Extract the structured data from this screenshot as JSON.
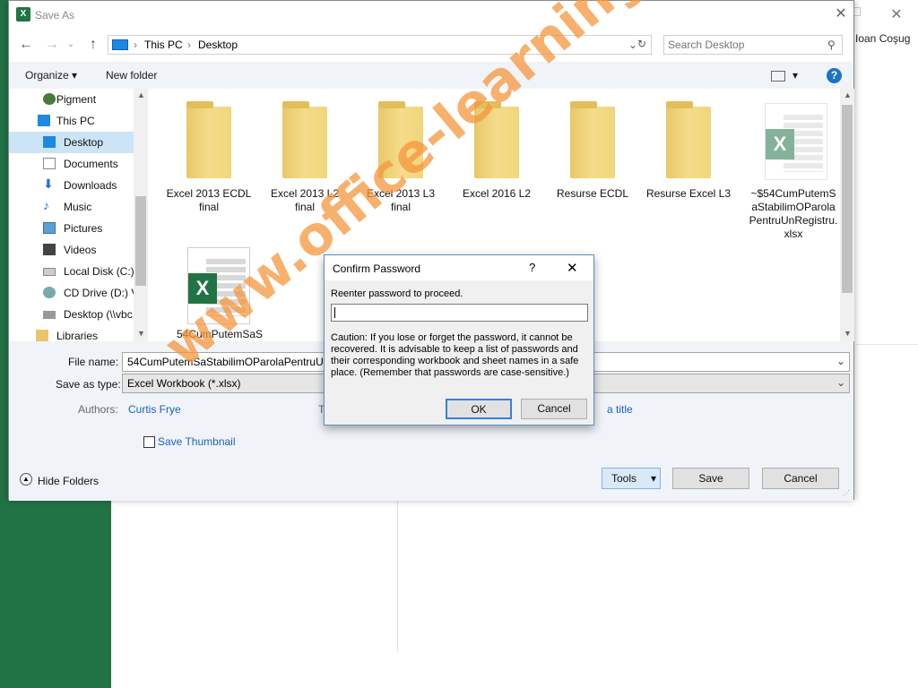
{
  "colors": {
    "excel_green": "#217346",
    "accent_blue": "#1a73c9",
    "selected": "#cce4f7",
    "watermark": "#f5963c"
  },
  "excel": {
    "user_name": "Ioan Coşug"
  },
  "save_as": {
    "title": "Save As",
    "breadcrumb": [
      "This PC",
      "Desktop"
    ],
    "search_placeholder": "Search Desktop",
    "toolbar": {
      "organize": "Organize",
      "new_folder": "New folder"
    },
    "nav": [
      {
        "label": "Pigment",
        "icon": "user-icon"
      },
      {
        "label": "This PC",
        "icon": "computer-icon"
      },
      {
        "label": "Desktop",
        "icon": "desktop-icon"
      },
      {
        "label": "Documents",
        "icon": "document-icon"
      },
      {
        "label": "Downloads",
        "icon": "download-icon"
      },
      {
        "label": "Music",
        "icon": "music-icon"
      },
      {
        "label": "Pictures",
        "icon": "picture-icon"
      },
      {
        "label": "Videos",
        "icon": "video-icon"
      },
      {
        "label": "Local Disk (C:)",
        "icon": "disk-icon"
      },
      {
        "label": "CD Drive (D:) V",
        "icon": "cd-drive-icon"
      },
      {
        "label": "Desktop (\\\\vbc",
        "icon": "network-drive-icon"
      },
      {
        "label": "Libraries",
        "icon": "library-icon"
      }
    ],
    "files": [
      {
        "name": "Excel 2013 ECDL final",
        "type": "folder"
      },
      {
        "name": "Excel 2013 L2 final",
        "type": "folder"
      },
      {
        "name": "Excel 2013 L3 final",
        "type": "folder"
      },
      {
        "name": "Excel 2016 L2",
        "type": "folder"
      },
      {
        "name": "Resurse ECDL",
        "type": "folder"
      },
      {
        "name": "Resurse Excel L3",
        "type": "folder"
      },
      {
        "name": "~$54CumPutemSaStabilimOParolaPentruUnRegistru.xlsx",
        "type": "excel"
      },
      {
        "name": "54CumPutemSaS",
        "type": "excel"
      }
    ],
    "form": {
      "file_name_label": "File name:",
      "file_name_value": "54CumPutemSaStabilimOParolaPentruUn",
      "save_type_label": "Save as type:",
      "save_type_value": "Excel Workbook (*.xlsx)",
      "authors_label": "Authors:",
      "authors_value": "Curtis Frye",
      "tags_label": "T",
      "title_value": "a title",
      "save_thumbnail": "Save Thumbnail",
      "hide_folders": "Hide Folders",
      "tools": "Tools",
      "save": "Save",
      "cancel": "Cancel"
    }
  },
  "confirm_password": {
    "title": "Confirm Password",
    "help": "?",
    "prompt": "Reenter password to proceed.",
    "caution": "Caution: If you lose or forget the password, it cannot be recovered. It is advisable to keep a list of passwords and their corresponding workbook and sheet names in a safe place.  (Remember that passwords are case-sensitive.)",
    "ok": "OK",
    "cancel": "Cancel"
  },
  "watermark": "www.office-learning.ro"
}
